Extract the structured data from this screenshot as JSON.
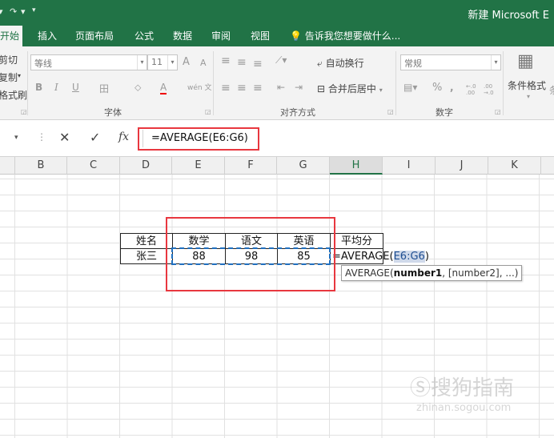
{
  "titlebar": {
    "qa_redo": "↷",
    "qa_more": "▾",
    "title": "新建 Microsoft E"
  },
  "tabs": [
    {
      "label": "开始",
      "active": true
    },
    {
      "label": "插入"
    },
    {
      "label": "页面布局"
    },
    {
      "label": "公式"
    },
    {
      "label": "数据"
    },
    {
      "label": "审阅"
    },
    {
      "label": "视图"
    }
  ],
  "tell_me": "告诉我您想要做什么...",
  "clipboard": {
    "cut": "剪切",
    "copy": "复制",
    "painter": "格式刷"
  },
  "font": {
    "name": "等线",
    "size": "11",
    "grow": "A",
    "shrink": "A",
    "bold": "B",
    "italic": "I",
    "underline": "U",
    "border": "田",
    "fill": "⬦",
    "font_color": "A",
    "phonetic": "wén 文",
    "group_label": "字体"
  },
  "alignment": {
    "wrap": "自动换行",
    "merge": "合并后居中",
    "group_label": "对齐方式"
  },
  "number": {
    "format": "常规",
    "percent": "%",
    "comma": ",",
    "inc_decimal": "←.0 .00",
    "dec_decimal": ".00 →.0",
    "group_label": "数字"
  },
  "styles": {
    "conditional": "条件格式"
  },
  "formula_bar": {
    "cancel": "✕",
    "enter": "✓",
    "fx": "fx",
    "formula": "=AVERAGE(E6:G6)"
  },
  "columns": [
    "B",
    "C",
    "D",
    "E",
    "F",
    "G",
    "H",
    "I",
    "J",
    "K"
  ],
  "active_column": "H",
  "table": {
    "headers": [
      "姓名",
      "数学",
      "语文",
      "英语",
      "平均分"
    ],
    "row": {
      "name": "张三",
      "math": "88",
      "chinese": "98",
      "english": "85",
      "formula_prefix": "=AVERAGE(",
      "formula_ref": "E6:G6",
      "formula_suffix": ")"
    }
  },
  "tooltip": {
    "fn": "AVERAGE(",
    "arg1": "number1",
    "rest": ", [number2], ...)"
  },
  "watermark": {
    "brand": "搜狗指南",
    "url": "zhinan.sogou.com"
  },
  "colors": {
    "excel_green": "#217346",
    "annotation_red": "#e8373f",
    "reference_blue": "#1f6fbf"
  }
}
